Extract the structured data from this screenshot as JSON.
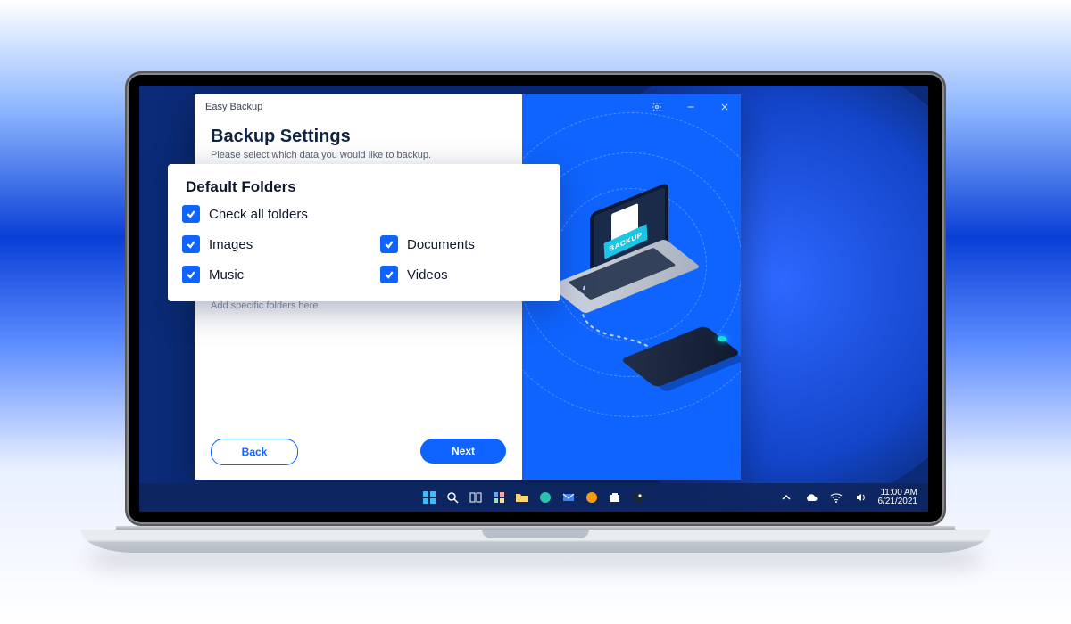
{
  "app": {
    "title": "Easy Backup"
  },
  "window_controls": {
    "settings": "Settings",
    "minimize": "Minimize",
    "close": "Close"
  },
  "page": {
    "title": "Backup Settings",
    "subtitle": "Please select which data you would like to backup."
  },
  "section": {
    "default_folders": "Default Folders"
  },
  "folders": {
    "check_all": {
      "label": "Check all folders",
      "checked": true
    },
    "images": {
      "label": "Images",
      "checked": true
    },
    "documents": {
      "label": "Documents",
      "checked": true
    },
    "music": {
      "label": "Music",
      "checked": true
    },
    "videos": {
      "label": "Videos",
      "checked": true
    }
  },
  "add_specific_placeholder": "Add specific folders here",
  "buttons": {
    "back": "Back",
    "next": "Next"
  },
  "illustration": {
    "tag": "BACKUP"
  },
  "taskbar": {
    "time": "11:00 AM",
    "date": "6/21/2021"
  }
}
